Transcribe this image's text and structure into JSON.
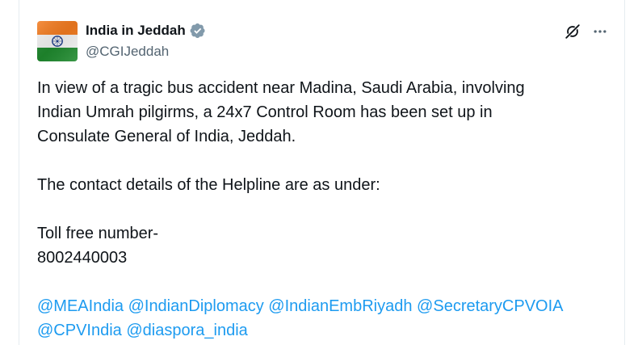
{
  "account": {
    "display_name": "India in Jeddah",
    "handle": "@CGIJeddah",
    "avatar_icon": "india-flag-icon",
    "verified_icon": "verified-badge-icon"
  },
  "actions": {
    "grok_icon": "grok-icon",
    "more_icon": "more-icon"
  },
  "tweet": {
    "line1": "In view of a tragic bus accident near Madina, Saudi Arabia, involving",
    "line2": "Indian Umrah pilgirms, a 24x7 Control Room has been set up in",
    "line3": "Consulate General of India, Jeddah.",
    "line4": "The contact details of the Helpline are as under:",
    "line5": "Toll free number-",
    "line6": "8002440003",
    "mentions": [
      "@MEAIndia",
      "@IndianDiplomacy",
      "@IndianEmbRiyadh",
      "@SecretaryCPVOIA",
      "@CPVIndia",
      "@diaspora_india"
    ]
  },
  "colors": {
    "text": "#0f1419",
    "secondary": "#536471",
    "link": "#1d9bf0",
    "verified": "#829aab"
  }
}
